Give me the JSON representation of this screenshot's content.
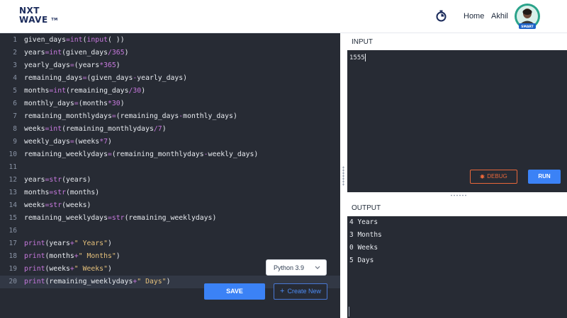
{
  "header": {
    "logo": {
      "line1": "NXT",
      "line2": "WAVE",
      "tm": "TM"
    },
    "nav_home": "Home",
    "user_name": "Akhil",
    "avatar_badge": "SMART"
  },
  "editor": {
    "lines": [
      {
        "n": "1",
        "tokens": [
          [
            "n",
            "given_days"
          ],
          [
            "o",
            "="
          ],
          [
            "f",
            "int"
          ],
          [
            "p",
            "("
          ],
          [
            "f",
            "input"
          ],
          [
            "p",
            "( ))"
          ]
        ]
      },
      {
        "n": "2",
        "tokens": [
          [
            "n",
            "years"
          ],
          [
            "o",
            "="
          ],
          [
            "f",
            "int"
          ],
          [
            "p",
            "(given_days"
          ],
          [
            "o",
            "/"
          ],
          [
            "num",
            "365"
          ],
          [
            "p",
            ")"
          ]
        ]
      },
      {
        "n": "3",
        "tokens": [
          [
            "n",
            "yearly_days"
          ],
          [
            "o",
            "="
          ],
          [
            "p",
            "(years"
          ],
          [
            "o",
            "*"
          ],
          [
            "num",
            "365"
          ],
          [
            "p",
            ")"
          ]
        ]
      },
      {
        "n": "4",
        "tokens": [
          [
            "n",
            "remaining_days"
          ],
          [
            "o",
            "="
          ],
          [
            "p",
            "(given_days"
          ],
          [
            "o",
            "-"
          ],
          [
            "p",
            "yearly_days)"
          ]
        ]
      },
      {
        "n": "5",
        "tokens": [
          [
            "n",
            "months"
          ],
          [
            "o",
            "="
          ],
          [
            "f",
            "int"
          ],
          [
            "p",
            "(remaining_days"
          ],
          [
            "o",
            "/"
          ],
          [
            "num",
            "30"
          ],
          [
            "p",
            ")"
          ]
        ]
      },
      {
        "n": "6",
        "tokens": [
          [
            "n",
            "monthly_days"
          ],
          [
            "o",
            "="
          ],
          [
            "p",
            "(months"
          ],
          [
            "o",
            "*"
          ],
          [
            "num",
            "30"
          ],
          [
            "p",
            ")"
          ]
        ]
      },
      {
        "n": "7",
        "tokens": [
          [
            "n",
            "remaining_monthlydays"
          ],
          [
            "o",
            "="
          ],
          [
            "p",
            "(remaining_days"
          ],
          [
            "o",
            "-"
          ],
          [
            "p",
            "monthly_days)"
          ]
        ]
      },
      {
        "n": "8",
        "tokens": [
          [
            "n",
            "weeks"
          ],
          [
            "o",
            "="
          ],
          [
            "f",
            "int"
          ],
          [
            "p",
            "(remaining_monthlydays"
          ],
          [
            "o",
            "/"
          ],
          [
            "num",
            "7"
          ],
          [
            "p",
            ")"
          ]
        ]
      },
      {
        "n": "9",
        "tokens": [
          [
            "n",
            "weekly_days"
          ],
          [
            "o",
            "="
          ],
          [
            "p",
            "(weeks"
          ],
          [
            "o",
            "*"
          ],
          [
            "num",
            "7"
          ],
          [
            "p",
            ")"
          ]
        ]
      },
      {
        "n": "10",
        "tokens": [
          [
            "n",
            "remaining_weeklydays"
          ],
          [
            "o",
            "="
          ],
          [
            "p",
            "(remaining_monthlydays"
          ],
          [
            "o",
            "-"
          ],
          [
            "p",
            "weekly_days)"
          ]
        ]
      },
      {
        "n": "11",
        "tokens": []
      },
      {
        "n": "12",
        "tokens": [
          [
            "n",
            "years"
          ],
          [
            "o",
            "="
          ],
          [
            "f",
            "str"
          ],
          [
            "p",
            "(years)"
          ]
        ]
      },
      {
        "n": "13",
        "tokens": [
          [
            "n",
            "months"
          ],
          [
            "o",
            "="
          ],
          [
            "f",
            "str"
          ],
          [
            "p",
            "(months)"
          ]
        ]
      },
      {
        "n": "14",
        "tokens": [
          [
            "n",
            "weeks"
          ],
          [
            "o",
            "="
          ],
          [
            "f",
            "str"
          ],
          [
            "p",
            "(weeks)"
          ]
        ]
      },
      {
        "n": "15",
        "tokens": [
          [
            "n",
            "remaining_weeklydays"
          ],
          [
            "o",
            "="
          ],
          [
            "f",
            "str"
          ],
          [
            "p",
            "(remaining_weeklydays)"
          ]
        ]
      },
      {
        "n": "16",
        "tokens": []
      },
      {
        "n": "17",
        "tokens": [
          [
            "f",
            "print"
          ],
          [
            "p",
            "(years"
          ],
          [
            "o",
            "+"
          ],
          [
            "s",
            "\" Years\""
          ],
          [
            "p",
            ")"
          ]
        ]
      },
      {
        "n": "18",
        "tokens": [
          [
            "f",
            "print"
          ],
          [
            "p",
            "(months"
          ],
          [
            "o",
            "+"
          ],
          [
            "s",
            "\" Months\""
          ],
          [
            "p",
            ")"
          ]
        ]
      },
      {
        "n": "19",
        "tokens": [
          [
            "f",
            "print"
          ],
          [
            "p",
            "(weeks"
          ],
          [
            "o",
            "+"
          ],
          [
            "s",
            "\" Weeks\""
          ],
          [
            "p",
            ")"
          ]
        ]
      },
      {
        "n": "20",
        "tokens": [
          [
            "f",
            "print"
          ],
          [
            "p",
            "(remaining_weeklydays"
          ],
          [
            "o",
            "+"
          ],
          [
            "s",
            "\" Days\""
          ],
          [
            "p",
            ")"
          ]
        ],
        "active": true
      }
    ],
    "language": "Python 3.9",
    "save_label": "SAVE",
    "new_label": "Create New",
    "new_icon": "+"
  },
  "input_panel": {
    "title": "INPUT",
    "value": "1555",
    "debug_label": "DEBUG",
    "run_label": "RUN"
  },
  "output_panel": {
    "title": "OUTPUT",
    "lines": [
      "4 Years",
      "3 Months",
      "0 Weeks",
      "5 Days"
    ]
  },
  "colors": {
    "editor_bg": "#272b34",
    "accent_blue": "#3b82f6",
    "debug_orange": "#e8673a",
    "brand_navy": "#1b2b5b"
  }
}
